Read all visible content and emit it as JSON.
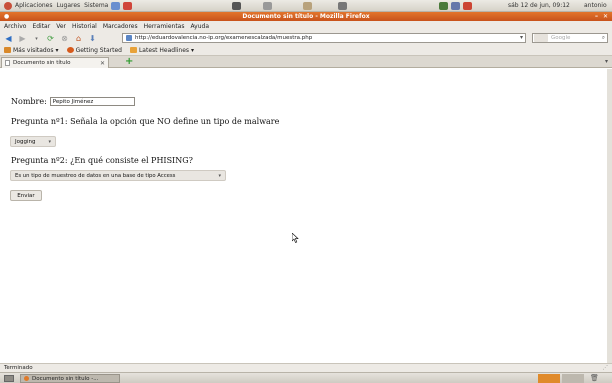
{
  "panel": {
    "menus": [
      "Aplicaciones",
      "Lugares",
      "Sistema"
    ],
    "clock": "sáb 12 de jun, 09:12",
    "user": "antonio"
  },
  "window": {
    "title": "Documento sin título - Mozilla Firefox"
  },
  "menubar": [
    "Archivo",
    "Editar",
    "Ver",
    "Historial",
    "Marcadores",
    "Herramientas",
    "Ayuda"
  ],
  "navbar": {
    "url": "http://eduardovalencia.no-ip.org/examenescalzada/muestra.php",
    "search_placeholder": "Google"
  },
  "bookmarks": [
    {
      "label": "Más visitados",
      "color": "#d9892a"
    },
    {
      "label": "Getting Started",
      "color": "#d65a1c"
    },
    {
      "label": "Latest Headlines",
      "color": "#e8a23a"
    }
  ],
  "tab": {
    "label": "Documento sin título"
  },
  "form": {
    "name_label": "Nombre:",
    "name_value": "Pepito Jiménez",
    "q1": "Pregunta nº1: Señala la opción que NO define un tipo de malware",
    "q1_selected": "Jogging",
    "q2": "Pregunta nº2: ¿En qué consiste el PHISING?",
    "q2_selected": "Es un tipo de muestreo de datos en una base de tipo Access",
    "submit_label": "Enviar"
  },
  "status": {
    "text": "Terminado"
  },
  "taskbar": {
    "item": "Documento sin título -..."
  },
  "colors": {
    "titlebar": "#d45f22",
    "panel": "#dcd8d0"
  }
}
